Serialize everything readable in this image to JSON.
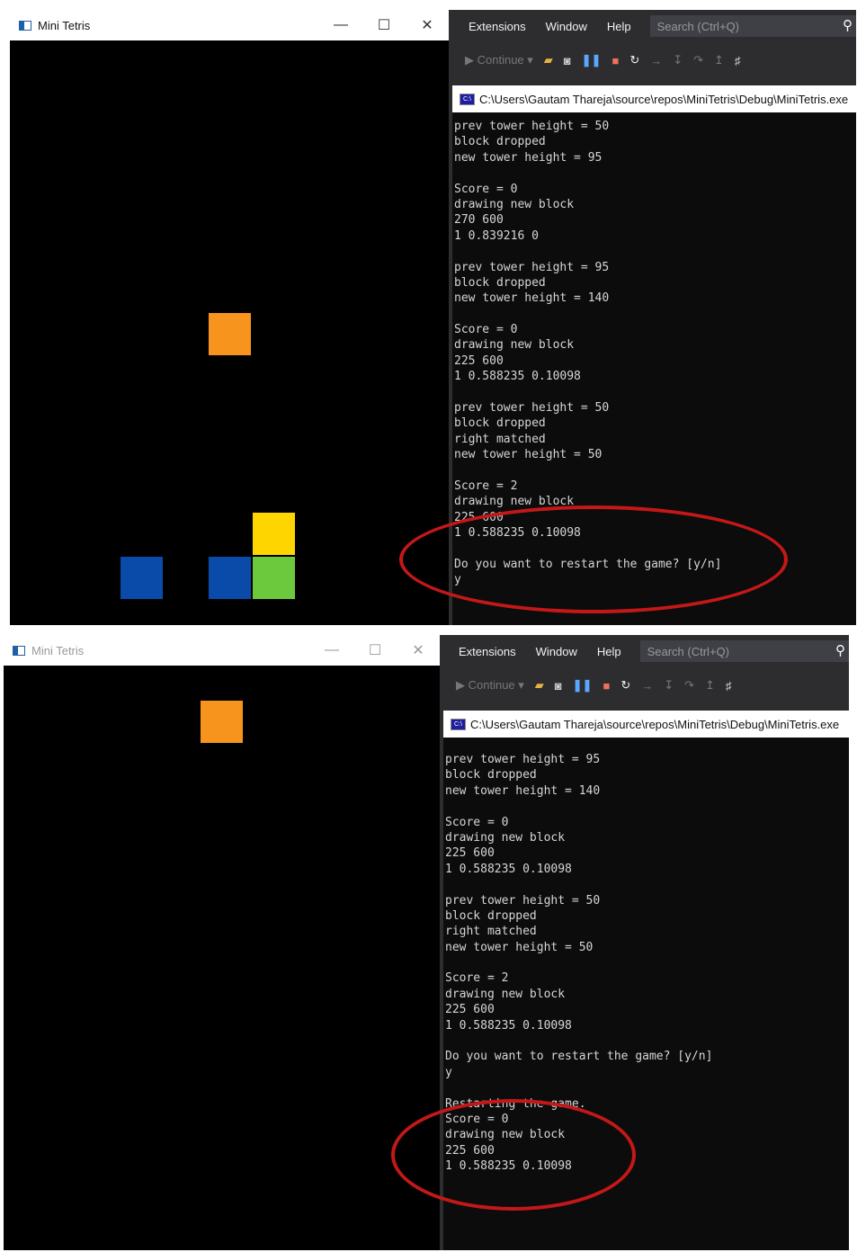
{
  "colors": {
    "orange": "#f7941d",
    "yellow": "#ffd500",
    "blue": "#0a4aa8",
    "green": "#6cc93e",
    "highlight": "#c41818"
  },
  "top": {
    "game_window": {
      "title": "Mini Tetris",
      "minimize": "—",
      "maximize": "☐",
      "close": "✕"
    },
    "vs": {
      "menu": [
        "Extensions",
        "Window",
        "Help"
      ],
      "search_placeholder": "Search (Ctrl+Q)",
      "continue_label": "▶ Continue ▾"
    },
    "console": {
      "title": "C:\\Users\\Gautam Thareja\\source\\repos\\MiniTetris\\Debug\\MiniTetris.exe",
      "lines": [
        "prev tower height = 50",
        "block dropped",
        "new tower height = 95",
        "",
        "Score = 0",
        "drawing new block",
        "270 600",
        "1 0.839216 0",
        "",
        "prev tower height = 95",
        "block dropped",
        "new tower height = 140",
        "",
        "Score = 0",
        "drawing new block",
        "225 600",
        "1 0.588235 0.10098",
        "",
        "prev tower height = 50",
        "block dropped",
        "right matched",
        "new tower height = 50",
        "",
        "Score = 2",
        "drawing new block",
        "225 600",
        "1 0.588235 0.10098",
        "",
        "Do you want to restart the game? [y/n]",
        "y"
      ]
    }
  },
  "bottom": {
    "game_window": {
      "title": "Mini Tetris",
      "minimize": "—",
      "maximize": "☐",
      "close": "✕"
    },
    "vs": {
      "menu": [
        "Extensions",
        "Window",
        "Help"
      ],
      "search_placeholder": "Search (Ctrl+Q)",
      "continue_label": "▶ Continue ▾"
    },
    "console": {
      "title": "C:\\Users\\Gautam Thareja\\source\\repos\\MiniTetris\\Debug\\MiniTetris.exe",
      "lines": [
        "prev tower height = 95",
        "block dropped",
        "new tower height = 140",
        "",
        "Score = 0",
        "drawing new block",
        "225 600",
        "1 0.588235 0.10098",
        "",
        "prev tower height = 50",
        "block dropped",
        "right matched",
        "new tower height = 50",
        "",
        "Score = 2",
        "drawing new block",
        "225 600",
        "1 0.588235 0.10098",
        "",
        "Do you want to restart the game? [y/n]",
        "y",
        "",
        "Restarting the game.",
        "Score = 0",
        "drawing new block",
        "225 600",
        "1 0.588235 0.10098"
      ]
    }
  }
}
